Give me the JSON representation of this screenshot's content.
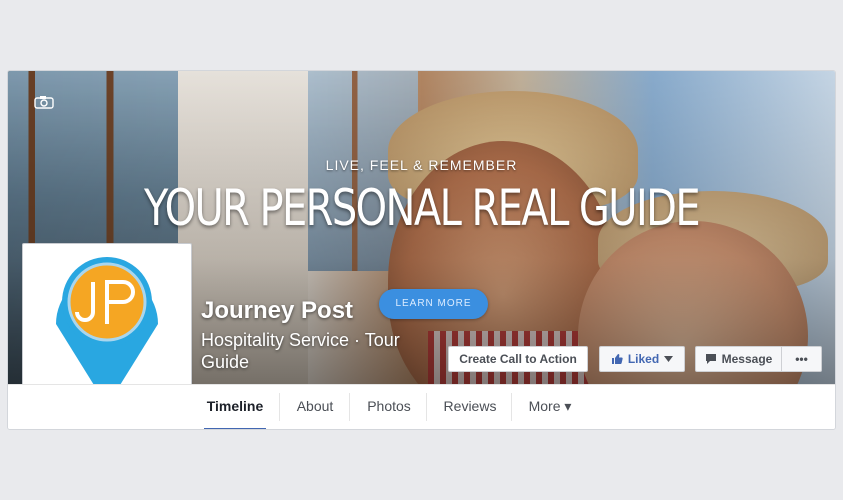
{
  "cover": {
    "tagline": "LIVE, FEEL & REMEMBER",
    "headline": "YOUR PERSONAL REAL GUIDE",
    "learn_more": "LEARN MORE"
  },
  "page": {
    "name": "Journey Post",
    "category": "Hospitality Service · Tour Guide",
    "logo_text": "JP"
  },
  "actions": {
    "cta_label": "Create Call to Action",
    "liked_label": "Liked",
    "message_label": "Message",
    "more_label": "•••"
  },
  "tabs": [
    {
      "label": "Timeline",
      "active": true
    },
    {
      "label": "About"
    },
    {
      "label": "Photos"
    },
    {
      "label": "Reviews"
    },
    {
      "label": "More ▾"
    }
  ],
  "colors": {
    "brand_blue": "#4267b2",
    "logo_pin": "#29a7e1",
    "logo_orange": "#f5a623"
  }
}
